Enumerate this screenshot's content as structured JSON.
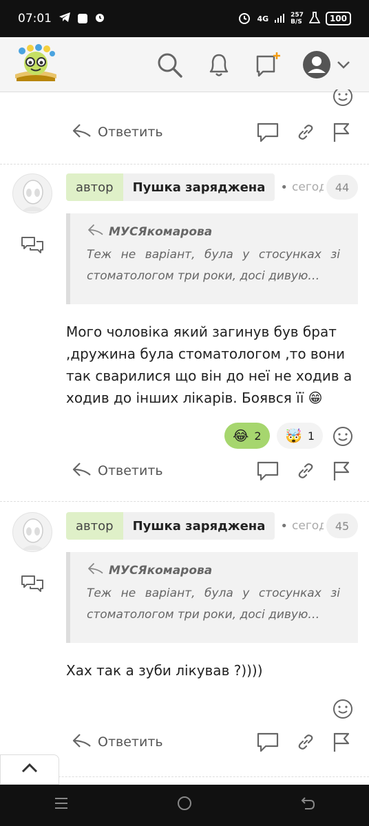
{
  "status_bar": {
    "time": "07:01",
    "network": "4G",
    "speed": "257\nB/S",
    "battery": "100"
  },
  "comments": [
    {
      "reply_label": "Ответить"
    },
    {
      "author_badge": "автор",
      "author_name": "Пушка заряджена",
      "time": "сегодня",
      "number": "44",
      "quote_author": "МУСЯкомарова",
      "quote_text": "Теж не варіант, була у стосунках зі стоматологом три роки, досі дивую…",
      "text": "Мого чоловіка який загинув був брат ,дружина була стоматологом ,то вони так сварилися що він до неї не ходив а ходив до інших лікарів. Боявся її 😁",
      "reactions": [
        {
          "emoji": "😂",
          "count": "2",
          "active": true
        },
        {
          "emoji": "🤯",
          "count": "1",
          "active": false
        }
      ],
      "reply_label": "Ответить"
    },
    {
      "author_badge": "автор",
      "author_name": "Пушка заряджена",
      "time": "сегодня",
      "number": "45",
      "quote_author": "МУСЯкомарова",
      "quote_text": "Теж не варіант, була у стосунках зі стоматологом три роки, досі дивую…",
      "text": "Хах так а зуби лікував ?))))",
      "reply_label": "Ответить"
    }
  ],
  "colors": {
    "accent_green": "#dff0c8",
    "reaction_active": "#a6d66e",
    "notify_orange": "#f39c12"
  },
  "icons": [
    "search-icon",
    "bell-icon",
    "new-chat-icon",
    "user-avatar-icon",
    "chevron-down-icon",
    "reply-arrow-icon",
    "comment-icon",
    "link-icon",
    "flag-icon",
    "smiley-icon",
    "chevron-up-icon"
  ]
}
